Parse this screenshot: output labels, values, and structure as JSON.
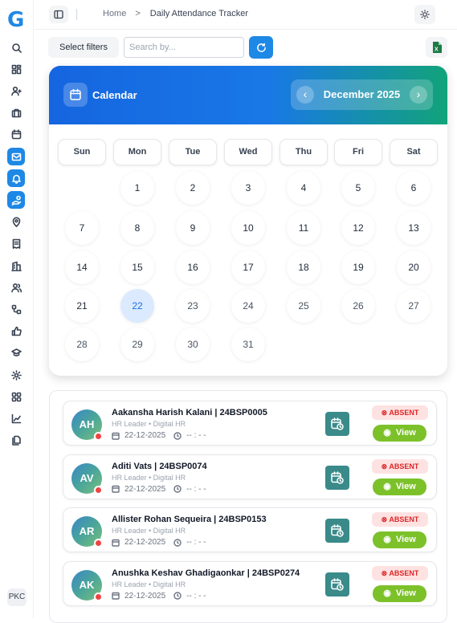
{
  "app": {
    "logo_letter": "G",
    "user_initials": "PKC"
  },
  "sidebar": {
    "items": [
      {
        "icon": "search-icon",
        "active": false
      },
      {
        "icon": "dashboard-icon",
        "active": false
      },
      {
        "icon": "user-add-icon",
        "active": false
      },
      {
        "icon": "briefcase-icon",
        "active": false
      },
      {
        "icon": "calendar-icon",
        "active": false
      },
      {
        "icon": "mail-icon",
        "active": true
      },
      {
        "icon": "bell-icon",
        "active": true
      },
      {
        "icon": "hand-coins-icon",
        "active": true
      },
      {
        "icon": "map-pin-icon",
        "active": false
      },
      {
        "icon": "receipt-icon",
        "active": false
      },
      {
        "icon": "building-icon",
        "active": false
      },
      {
        "icon": "users-icon",
        "active": false
      },
      {
        "icon": "workflow-icon",
        "active": false
      },
      {
        "icon": "thumbs-up-icon",
        "active": false
      },
      {
        "icon": "graduation-cap-icon",
        "active": false
      },
      {
        "icon": "settings-icon",
        "active": false
      },
      {
        "icon": "apps-icon",
        "active": false
      },
      {
        "icon": "chart-icon",
        "active": false
      },
      {
        "icon": "documents-icon",
        "active": false
      }
    ]
  },
  "breadcrumb": {
    "home": "Home",
    "separator": ">",
    "current": "Daily Attendance Tracker"
  },
  "toolbar": {
    "filters_label": "Select filters",
    "search_placeholder": "Search by..."
  },
  "calendar": {
    "title": "Calendar",
    "month_label": "December 2025",
    "prev": "‹",
    "next": "›",
    "weekdays": [
      "Sun",
      "Mon",
      "Tue",
      "Wed",
      "Thu",
      "Fri",
      "Sat"
    ],
    "first_weekday_index": 1,
    "days_in_month": 31,
    "today": 22
  },
  "records": [
    {
      "initials": "AH",
      "name": "Aakansha Harish Kalani | 24BSP0005",
      "role": "HR Leader • Digital HR",
      "date": "22-12-2025",
      "time": "-- : - -",
      "status": "ABSENT",
      "view_label": "View"
    },
    {
      "initials": "AV",
      "name": "Aditi Vats | 24BSP0074",
      "role": "HR Leader • Digital HR",
      "date": "22-12-2025",
      "time": "-- : - -",
      "status": "ABSENT",
      "view_label": "View"
    },
    {
      "initials": "AR",
      "name": "Allister Rohan Sequeira | 24BSP0153",
      "role": "HR Leader • Digital HR",
      "date": "22-12-2025",
      "time": "-- : - -",
      "status": "ABSENT",
      "view_label": "View"
    },
    {
      "initials": "AK",
      "name": "Anushka Keshav Ghadigaonkar | 24BSP0274",
      "role": "HR Leader • Digital HR",
      "date": "22-12-2025",
      "time": "-- : - -",
      "status": "ABSENT",
      "view_label": "View"
    }
  ],
  "colors": {
    "primary": "#1e88e5",
    "absent_bg": "#fee2e2",
    "absent_text": "#dc2626",
    "view_bg": "#7cc12a",
    "calendar_action_bg": "#3a8a8a"
  }
}
